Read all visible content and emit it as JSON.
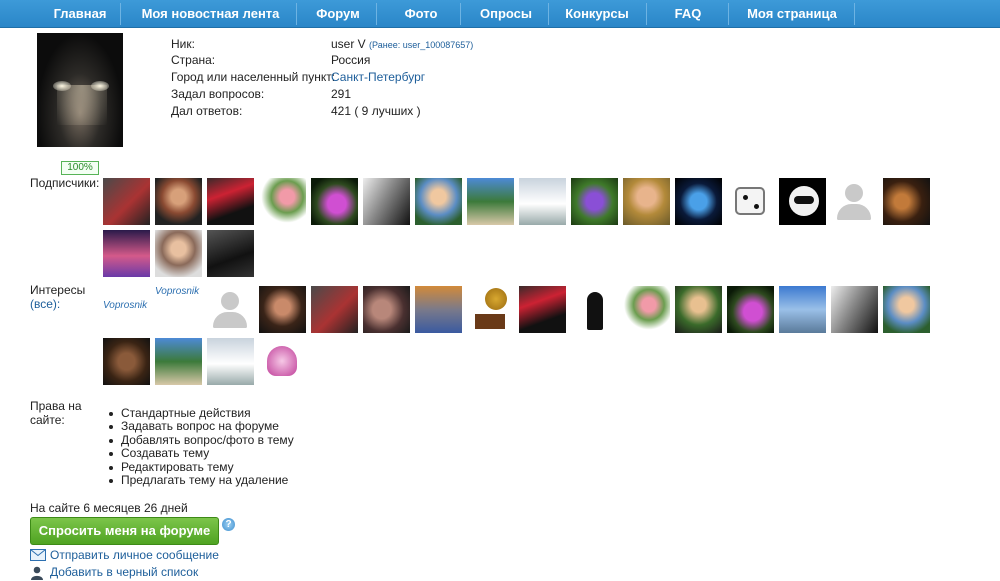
{
  "nav": {
    "items": [
      "Главная",
      "Моя новостная лента",
      "Форум",
      "Фото",
      "Опросы",
      "Конкурсы",
      "FAQ",
      "Моя страница"
    ],
    "bg": "#2a86c8"
  },
  "profile": {
    "nick_label": "Ник:",
    "nick_value": "user V",
    "nick_prev": "(Ранее: user_100087657)",
    "country_label": "Страна:",
    "country_value": "Россия",
    "city_label": "Город или населенный пункт:",
    "city_value": "Санкт-Петербург",
    "questions_label": "Задал вопросов:",
    "questions_value": "291",
    "answers_label": "Дал ответов:",
    "answers_value": "421 ( 9 лучших )"
  },
  "percent_badge": "100%",
  "subscribers": {
    "label": "Подписчики:"
  },
  "interests": {
    "label_line1": "Интересы",
    "label_line2": "(все):",
    "logo_text": "Voprosnik"
  },
  "rights": {
    "label_line1": "Права на",
    "label_line2": "сайте:",
    "items": [
      "Стандартные действия",
      "Задавать вопрос на форуме",
      "Добавлять вопрос/фото в тему",
      "Создавать тему",
      "Редактировать тему",
      "Предлагать тему на удаление"
    ]
  },
  "since": "На сайте 6 месяцев 26 дней",
  "ask_button": "Спросить меня на форуме",
  "help_icon_text": "?",
  "actions": {
    "message": "Отправить личное сообщение",
    "blacklist": "Добавить в черный список"
  },
  "colors": {
    "link": "#1d5e9a",
    "button": "#5aad2c",
    "badge": "#2b8a2b"
  }
}
